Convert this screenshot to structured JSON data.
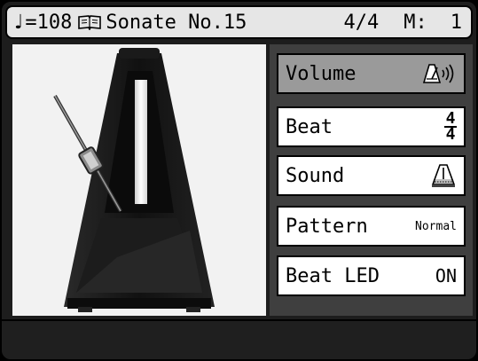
{
  "status_bar": {
    "tempo": "=108",
    "song_title": "Sonate No.15",
    "time_signature": "4/4",
    "measure_label": "M:",
    "measure_value": "1"
  },
  "menu": {
    "items": [
      {
        "label": "Volume",
        "icon": "volume-speaker-icon",
        "selected": true
      },
      {
        "label": "Beat",
        "value_numerator": "4",
        "value_denominator": "4"
      },
      {
        "label": "Sound",
        "icon": "metronome-bell-icon"
      },
      {
        "label": "Pattern",
        "value": "Normal"
      },
      {
        "label": "Beat LED",
        "value": "ON"
      }
    ]
  },
  "illustration": {
    "icon": "metronome-illustration"
  }
}
